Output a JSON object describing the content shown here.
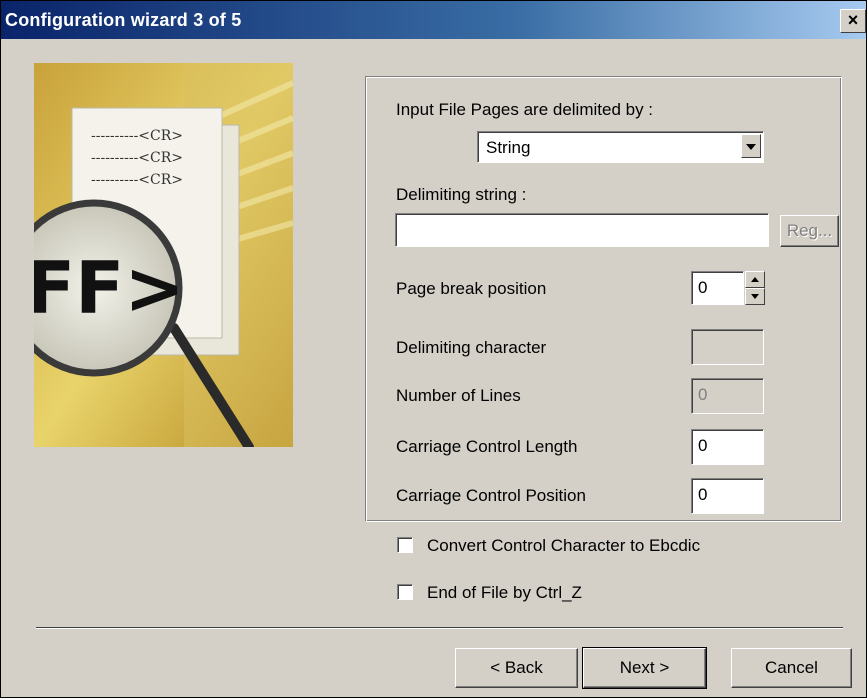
{
  "window": {
    "title": "Configuration wizard 3 of 5",
    "close_glyph": "×"
  },
  "illustration": {
    "lines": [
      "----------<CR>",
      "----------<CR>",
      "----------<CR>"
    ],
    "logo_text": "FF>"
  },
  "form": {
    "delimited_by_label": "Input File Pages are delimited by :",
    "delimited_by_value": "String",
    "delimiting_string_label": "Delimiting string :",
    "delimiting_string_value": "",
    "reg_button": "Reg...",
    "page_break_label": "Page break position",
    "page_break_value": "0",
    "delimiting_char_label": "Delimiting character",
    "delimiting_char_value": "",
    "num_lines_label": "Number of Lines",
    "num_lines_value": "0",
    "cc_length_label": "Carriage Control Length",
    "cc_length_value": "0",
    "cc_position_label": "Carriage Control Position",
    "cc_position_value": "0"
  },
  "checkboxes": {
    "ebcdic_label": "Convert Control Character to Ebcdic",
    "ctrlz_label": "End of File by Ctrl_Z"
  },
  "buttons": {
    "back": "< Back",
    "next": "Next >",
    "cancel": "Cancel"
  }
}
